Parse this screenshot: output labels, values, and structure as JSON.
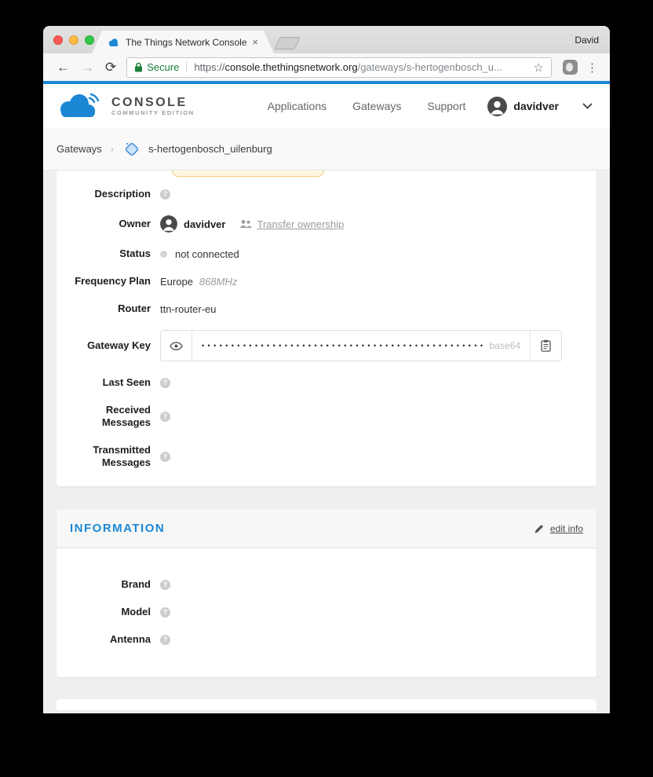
{
  "browser": {
    "window_user": "David",
    "tab_title": "The Things Network Console",
    "close_glyph": "×",
    "back_glyph": "←",
    "forward_glyph": "→",
    "reload_glyph": "⟳",
    "secure_label": "Secure",
    "url_scheme": "https://",
    "url_host": "console.thethingsnetwork.org",
    "url_path": "/gateways/s-hertogenbosch_u...",
    "star_glyph": "☆",
    "menu_glyph": "⋮"
  },
  "header": {
    "logo_title": "CONSOLE",
    "logo_subtitle": "COMMUNITY EDITION",
    "nav": [
      {
        "label": "Applications"
      },
      {
        "label": "Gateways"
      },
      {
        "label": "Support"
      }
    ],
    "user_name": "davidver"
  },
  "breadcrumb": {
    "root": "Gateways",
    "separator": "›",
    "current": "s-hertogenbosch_uilenburg"
  },
  "overview": {
    "description_label": "Description",
    "owner_label": "Owner",
    "owner_name": "davidver",
    "transfer_ownership_label": "Transfer ownership",
    "status_label": "Status",
    "status_value": "not connected",
    "frequency_plan_label": "Frequency Plan",
    "frequency_plan_region": "Europe",
    "frequency_plan_band": "868MHz",
    "router_label": "Router",
    "router_value": "ttn-router-eu",
    "gateway_key_label": "Gateway Key",
    "gateway_key_masked": "••••••••••••••••••••••••••••••••••••••••••••••••",
    "gateway_key_encoding": "base64",
    "last_seen_label": "Last Seen",
    "received_messages_label": "Received Messages",
    "transmitted_messages_label": "Transmitted Messages",
    "help_glyph": "?"
  },
  "information": {
    "title": "INFORMATION",
    "edit_label": "edit info",
    "brand_label": "Brand",
    "model_label": "Model",
    "antenna_label": "Antenna"
  },
  "colors": {
    "accent_blue": "#1B87D4",
    "secure_green": "#188038",
    "highlight_border": "#F5C878",
    "highlight_bg": "#FFF8E1"
  }
}
